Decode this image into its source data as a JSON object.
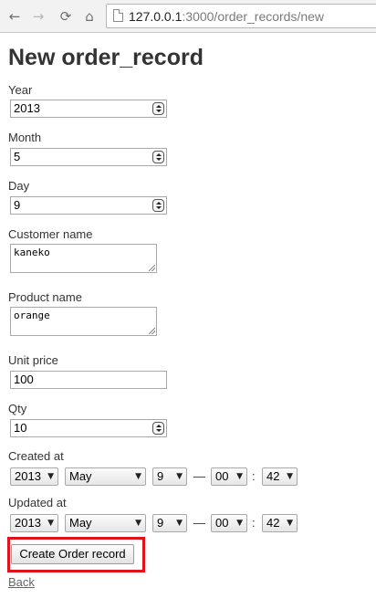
{
  "browser": {
    "back_icon": "arrow-left-icon",
    "forward_icon": "arrow-right-icon",
    "reload_icon": "reload-icon",
    "home_icon": "home-icon",
    "url_host": "127.0.0.1",
    "url_path": ":3000/order_records/new"
  },
  "page": {
    "title": "New order_record"
  },
  "form": {
    "year": {
      "label": "Year",
      "value": "2013"
    },
    "month": {
      "label": "Month",
      "value": "5"
    },
    "day": {
      "label": "Day",
      "value": "9"
    },
    "customer_name": {
      "label": "Customer name",
      "value": "kaneko"
    },
    "product_name": {
      "label": "Product name",
      "value": "orange"
    },
    "unit_price": {
      "label": "Unit price",
      "value": "100"
    },
    "qty": {
      "label": "Qty",
      "value": "10"
    },
    "created_at": {
      "label": "Created at",
      "year": "2013",
      "month": "May",
      "day": "9",
      "hour": "00",
      "minute": "42",
      "date_time_separator": "—",
      "time_separator": ":"
    },
    "updated_at": {
      "label": "Updated at",
      "year": "2013",
      "month": "May",
      "day": "9",
      "hour": "00",
      "minute": "42",
      "date_time_separator": "—",
      "time_separator": ":"
    },
    "submit_label": "Create Order record",
    "back_label": "Back"
  },
  "colors": {
    "highlight_box": "#e0121b",
    "link": "#666666",
    "heading": "#333333"
  }
}
